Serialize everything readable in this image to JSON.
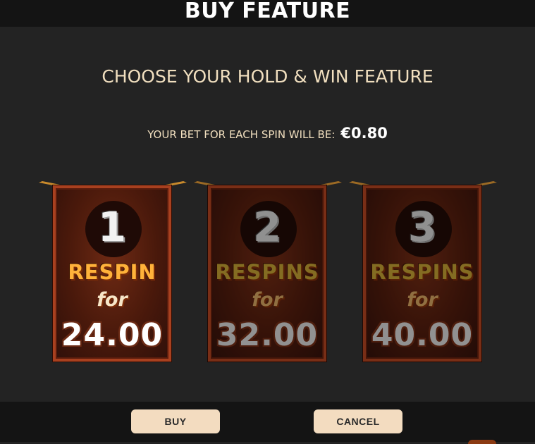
{
  "header": {
    "title": "BUY FEATURE"
  },
  "main": {
    "subtitle": "CHOOSE YOUR HOLD & WIN FEATURE",
    "bet_label": "YOUR BET FOR EACH SPIN WILL BE:",
    "bet_amount": "€0.80",
    "options": [
      {
        "number": "1",
        "label": "RESPIN",
        "for_text": "for",
        "price": "24.00",
        "selected": true
      },
      {
        "number": "2",
        "label": "RESPINS",
        "for_text": "for",
        "price": "32.00",
        "selected": false
      },
      {
        "number": "3",
        "label": "RESPINS",
        "for_text": "for",
        "price": "40.00",
        "selected": false
      }
    ]
  },
  "footer": {
    "buy_label": "BUY",
    "cancel_label": "CANCEL"
  },
  "colors": {
    "accent": "#f3dcc0",
    "frame": "#a8401f",
    "gold": "#e8b548"
  }
}
